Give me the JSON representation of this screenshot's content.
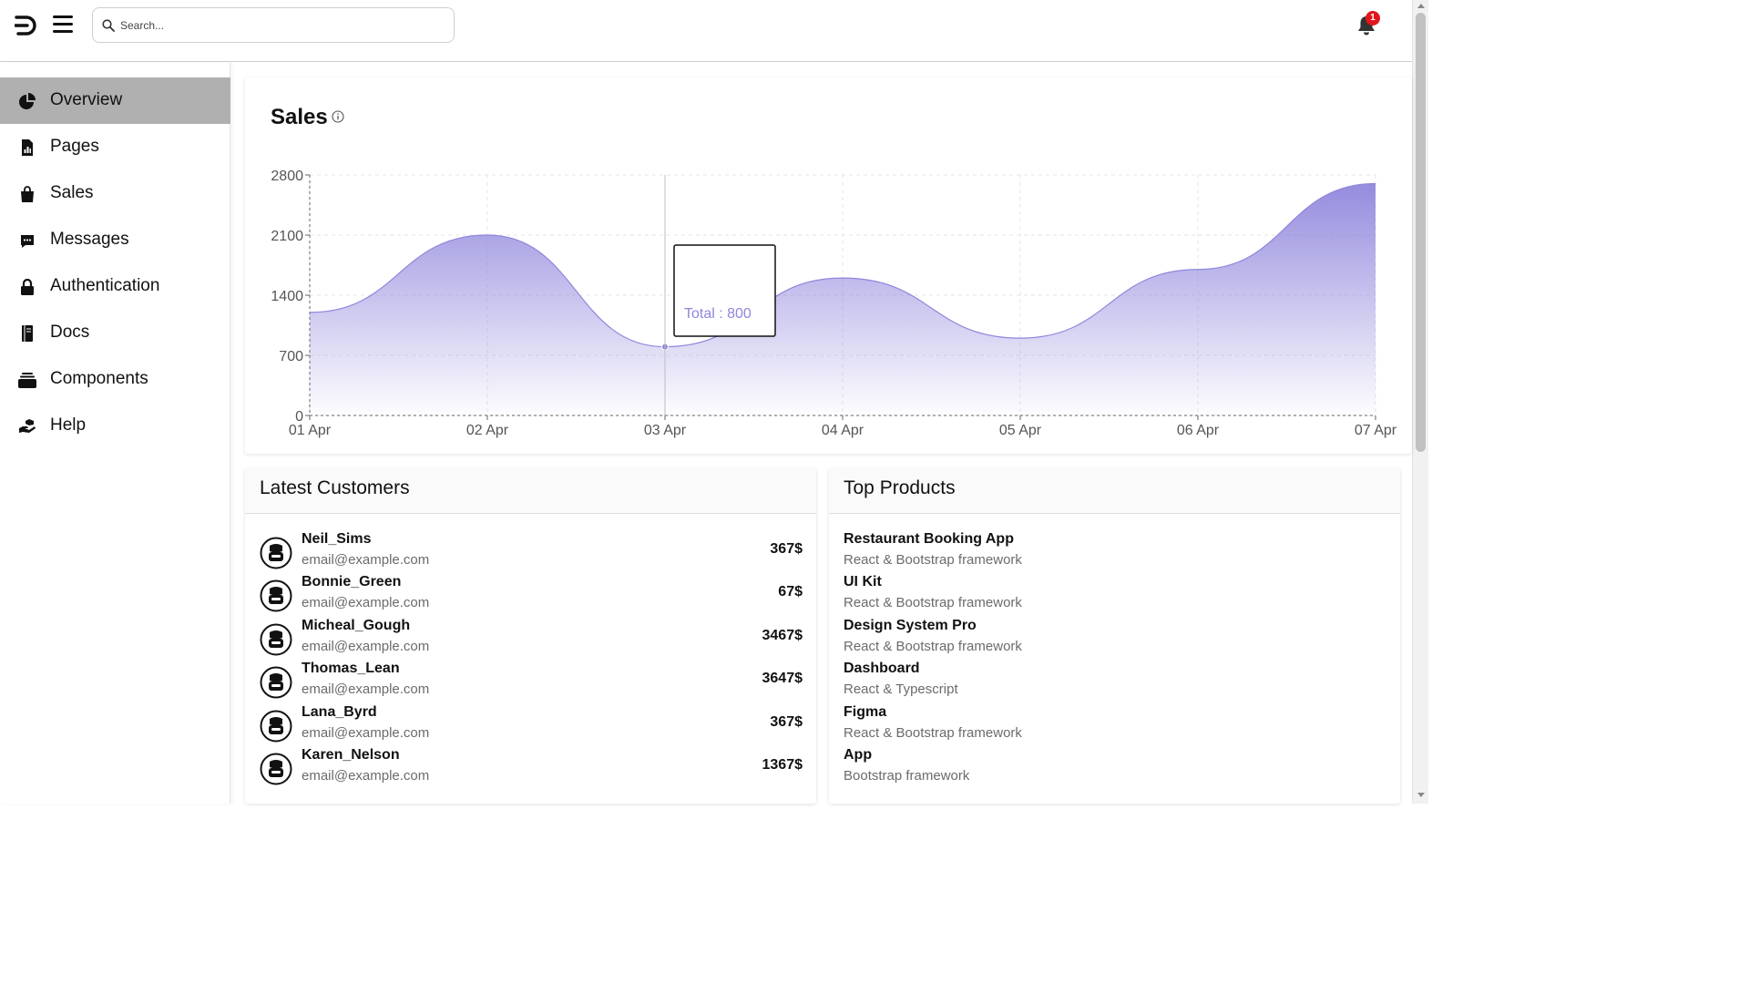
{
  "header": {
    "search_placeholder": "Search...",
    "notifications_count": "1"
  },
  "sidebar": {
    "items": [
      {
        "label": "Overview",
        "icon": "pie-chart-icon",
        "active": true
      },
      {
        "label": "Pages",
        "icon": "file-chart-icon",
        "active": false
      },
      {
        "label": "Sales",
        "icon": "shopping-bag-icon",
        "active": false
      },
      {
        "label": "Messages",
        "icon": "chat-icon",
        "active": false
      },
      {
        "label": "Authentication",
        "icon": "lock-icon",
        "active": false
      },
      {
        "label": "Docs",
        "icon": "book-icon",
        "active": false
      },
      {
        "label": "Components",
        "icon": "layers-icon",
        "active": false
      },
      {
        "label": "Help",
        "icon": "hand-help-icon",
        "active": false
      }
    ]
  },
  "sales": {
    "title": "Sales",
    "tooltip": "Total : 800",
    "accent_color": "#8f86dc"
  },
  "chart_data": {
    "type": "area",
    "categories": [
      "01 Apr",
      "02 Apr",
      "03 Apr",
      "04 Apr",
      "05 Apr",
      "06 Apr",
      "07 Apr"
    ],
    "series": [
      {
        "values": [
          1200,
          2100,
          800,
          1600,
          900,
          1700,
          2700
        ]
      }
    ],
    "y_ticks": [
      0,
      700,
      1400,
      2100,
      2800
    ],
    "ylim": [
      0,
      2800
    ],
    "grid": true,
    "highlighted_point": {
      "category": "03 Apr",
      "value": 800
    }
  },
  "customers": {
    "title": "Latest Customers",
    "rows": [
      {
        "name": "Neil_Sims",
        "email": "email@example.com",
        "amount": "367$"
      },
      {
        "name": "Bonnie_Green",
        "email": "email@example.com",
        "amount": "67$"
      },
      {
        "name": "Micheal_Gough",
        "email": "email@example.com",
        "amount": "3467$"
      },
      {
        "name": "Thomas_Lean",
        "email": "email@example.com",
        "amount": "3647$"
      },
      {
        "name": "Lana_Byrd",
        "email": "email@example.com",
        "amount": "367$"
      },
      {
        "name": "Karen_Nelson",
        "email": "email@example.com",
        "amount": "1367$"
      }
    ]
  },
  "products": {
    "title": "Top Products",
    "rows": [
      {
        "name": "Restaurant Booking App",
        "desc": "React & Bootstrap framework"
      },
      {
        "name": "UI Kit",
        "desc": "React & Bootstrap framework"
      },
      {
        "name": "Design System Pro",
        "desc": "React & Bootstrap framework"
      },
      {
        "name": "Dashboard",
        "desc": "React & Typescript"
      },
      {
        "name": "Figma",
        "desc": "React & Bootstrap framework"
      },
      {
        "name": "App",
        "desc": "Bootstrap framework"
      }
    ]
  }
}
